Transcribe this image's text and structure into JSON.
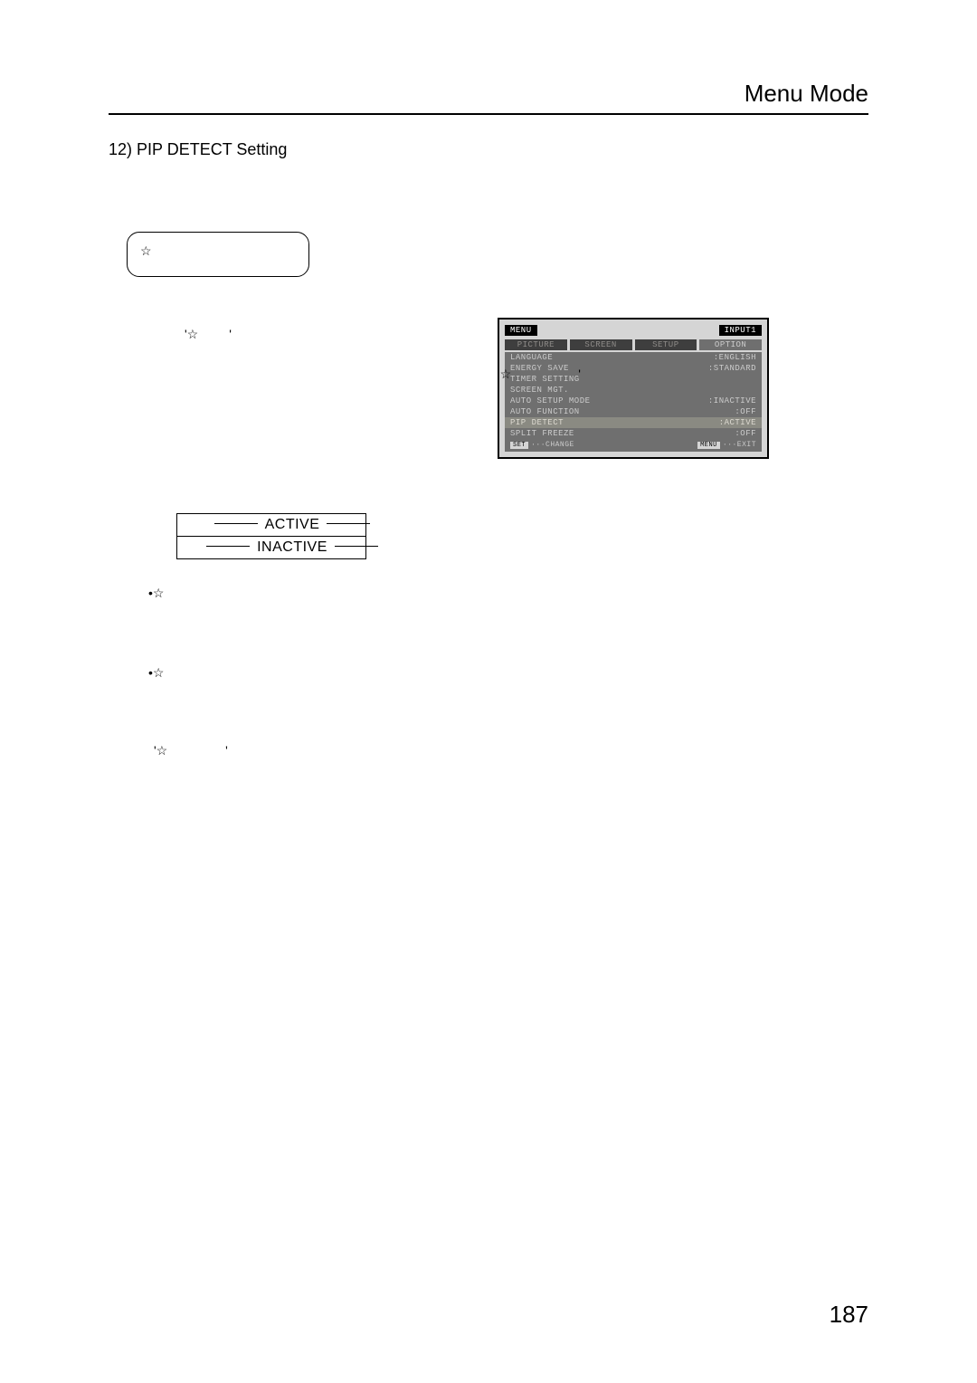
{
  "header": {
    "title": "Menu Mode"
  },
  "section": {
    "heading": "12) PIP DETECT Setting"
  },
  "diagram": {
    "star": "☆",
    "quote_a_left": "'☆",
    "quote_a_right": "'",
    "quote_b_left": "'☆",
    "quote_b_right": "'",
    "label_active": "ACTIVE",
    "label_inactive": "INACTIVE"
  },
  "bullets": {
    "b1": "•☆",
    "b2": "•☆"
  },
  "star_quote": {
    "left": "'☆",
    "right": "'"
  },
  "osd": {
    "menu_label": "MENU",
    "input_label": "INPUT1",
    "tabs": {
      "picture": "PICTURE",
      "screen": "SCREEN",
      "setup": "SETUP",
      "option": "OPTION"
    },
    "rows": {
      "language": {
        "k": "LANGUAGE",
        "v": ":ENGLISH"
      },
      "energy": {
        "k": "ENERGY SAVE",
        "v": ":STANDARD"
      },
      "timer": {
        "k": "TIMER SETTING",
        "v": ""
      },
      "screenmgt": {
        "k": "SCREEN MGT.",
        "v": ""
      },
      "auto_setup": {
        "k": "AUTO SETUP MODE",
        "v": ":INACTIVE"
      },
      "auto_func": {
        "k": "AUTO FUNCTION",
        "v": ":OFF"
      },
      "pip": {
        "k": "PIP DETECT",
        "v": ":ACTIVE"
      },
      "split": {
        "k": "SPLIT FREEZE",
        "v": ":OFF"
      }
    },
    "footer": {
      "set_key": "SET",
      "set_text": "···CHANGE",
      "menu_key": "MENU",
      "menu_text": "···EXIT"
    }
  },
  "page_number": "187"
}
